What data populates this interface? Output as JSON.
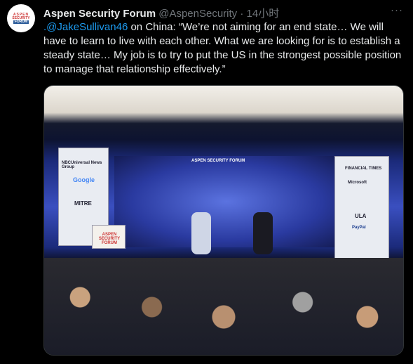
{
  "tweet": {
    "avatar_text": [
      "ASPEN",
      "SECURITY",
      "FORUM"
    ],
    "display_name": "Aspen Security Forum",
    "handle": "@AspenSecurity",
    "separator": "·",
    "time": "14小时",
    "more_icon": "···",
    "mention": ".@JakeSullivan46",
    "body": " on China: “We’re not aiming for an end state… We will have to learn to live with each other.  What we are looking for is to establish a steady state… My job is to try to put the US in the strongest possible position to manage that relationship effectively.”",
    "photo": {
      "podium_text": "ASPEN SECURITY FORUM",
      "left_banner": [
        "NBCUniversal News Group",
        "Google",
        "MITRE"
      ],
      "right_banner": [
        "FINANCIAL TIMES",
        "Microsoft",
        "ULA",
        "PayPal"
      ],
      "backdrop_text": "ASPEN SECURITY FORUM"
    }
  },
  "colors": {
    "link": "#1d9bf0",
    "secondary": "#71767b"
  }
}
